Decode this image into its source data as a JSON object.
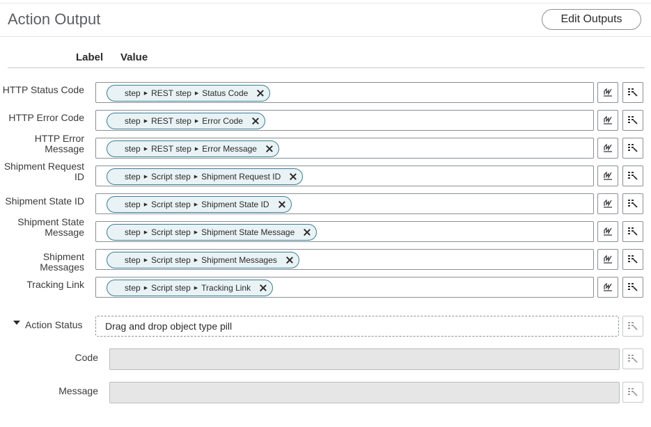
{
  "header": {
    "title": "Action Output",
    "edit_button": "Edit Outputs"
  },
  "columns": {
    "label": "Label",
    "value": "Value"
  },
  "outputs": [
    {
      "label": "HTTP Status Code",
      "path": [
        "step",
        "REST step",
        "Status Code"
      ]
    },
    {
      "label": "HTTP Error Code",
      "path": [
        "step",
        "REST step",
        "Error Code"
      ]
    },
    {
      "label": "HTTP Error Message",
      "path": [
        "step",
        "REST step",
        "Error Message"
      ]
    },
    {
      "label": "Shipment Request ID",
      "path": [
        "step",
        "Script step",
        "Shipment Request ID"
      ]
    },
    {
      "label": "Shipment State ID",
      "path": [
        "step",
        "Script step",
        "Shipment State ID"
      ]
    },
    {
      "label": "Shipment State Message",
      "path": [
        "step",
        "Script step",
        "Shipment State Message"
      ]
    },
    {
      "label": "Shipment Messages",
      "path": [
        "step",
        "Script step",
        "Shipment Messages"
      ]
    },
    {
      "label": "Tracking Link",
      "path": [
        "step",
        "Script step",
        "Tracking Link"
      ]
    }
  ],
  "action_status": {
    "label": "Action Status",
    "drop_placeholder": "Drag and drop object type pill",
    "fields": [
      {
        "label": "Code",
        "value": ""
      },
      {
        "label": "Message",
        "value": ""
      }
    ]
  },
  "icons": {
    "script_button": "script-icon",
    "picker_button": "data-pill-picker-icon"
  },
  "colors": {
    "pill_border": "#3b7d93",
    "pill_bg": "#e9f2f5",
    "readonly_bg": "#e6e6e6"
  }
}
